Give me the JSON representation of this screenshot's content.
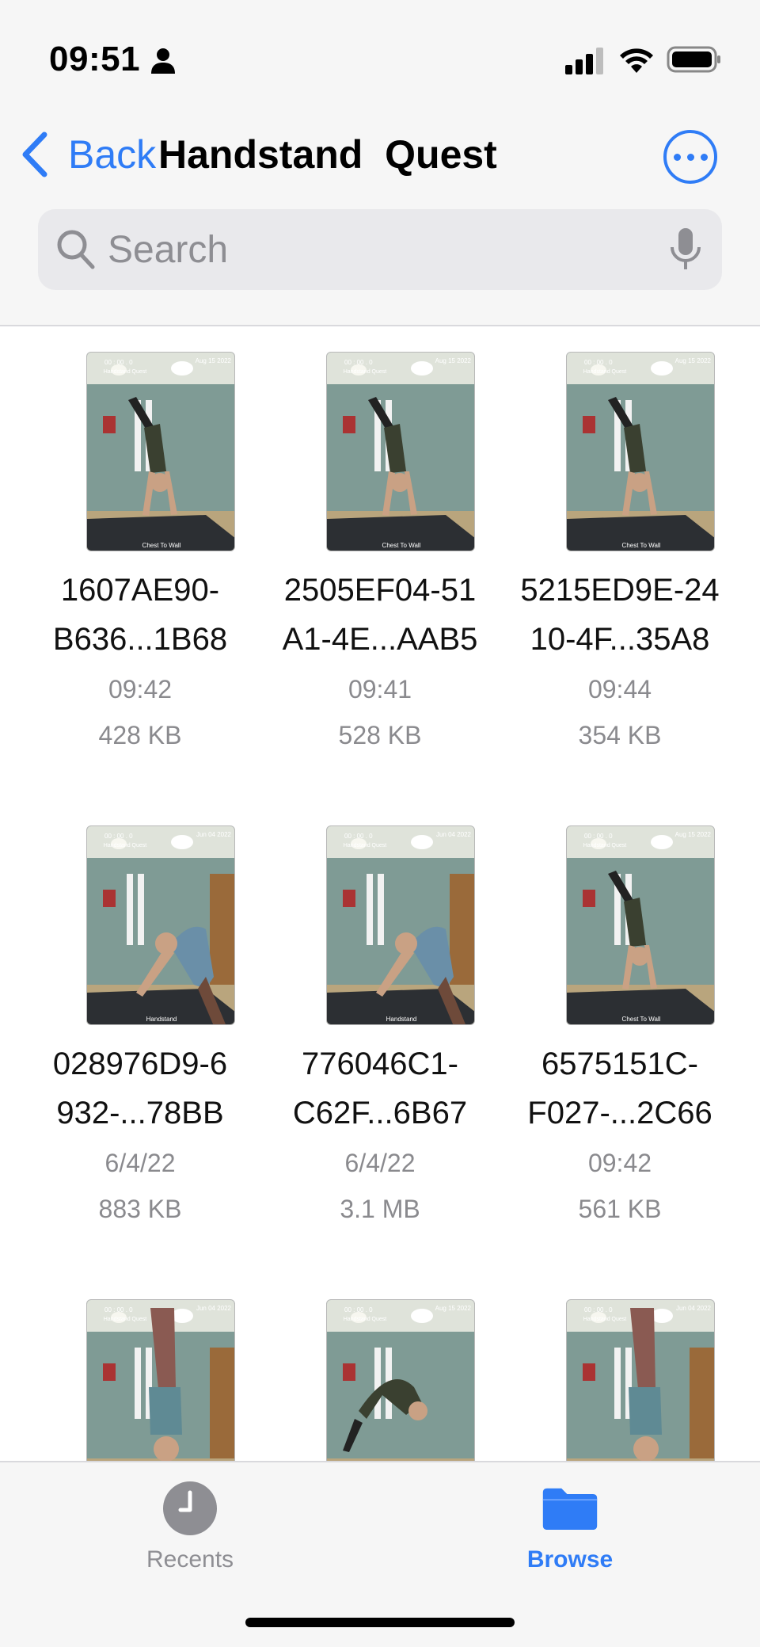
{
  "status_bar": {
    "time": "09:51"
  },
  "nav": {
    "back_label": "Back",
    "title": "Handstand  Quest",
    "more_icon": "ellipsis-circle-icon"
  },
  "search": {
    "placeholder": "Search"
  },
  "files": [
    {
      "name_line1": "1607AE90-",
      "name_line2": "B636...1B68",
      "date": "09:42",
      "size": "428 KB",
      "thumb_date": "Aug 15 2022",
      "thumb_timer": "00 : 00 . 0",
      "thumb_app": "Handstand Quest",
      "thumb_caption": "Chest To Wall"
    },
    {
      "name_line1": "2505EF04-51",
      "name_line2": "A1-4E...AAB5",
      "date": "09:41",
      "size": "528 KB",
      "thumb_date": "Aug 15 2022",
      "thumb_timer": "00 : 00 . 0",
      "thumb_app": "Handstand Quest",
      "thumb_caption": "Chest To Wall"
    },
    {
      "name_line1": "5215ED9E-24",
      "name_line2": "10-4F...35A8",
      "date": "09:44",
      "size": "354 KB",
      "thumb_date": "Aug 15 2022",
      "thumb_timer": "00 : 00 . 0",
      "thumb_app": "Handstand Quest",
      "thumb_caption": "Chest To Wall"
    },
    {
      "name_line1": "028976D9-6",
      "name_line2": "932-...78BB",
      "date": "6/4/22",
      "size": "883 KB",
      "thumb_date": "Jun 04 2022",
      "thumb_timer": "00 : 00 . 0",
      "thumb_app": "Handstand Quest",
      "thumb_caption": "Handstand"
    },
    {
      "name_line1": "776046C1-",
      "name_line2": "C62F...6B67",
      "date": "6/4/22",
      "size": "3.1 MB",
      "thumb_date": "Jun 04 2022",
      "thumb_timer": "00 : 00 . 0",
      "thumb_app": "Handstand Quest",
      "thumb_caption": "Handstand"
    },
    {
      "name_line1": "6575151C-",
      "name_line2": "F027-...2C66",
      "date": "09:42",
      "size": "561 KB",
      "thumb_date": "Aug 15 2022",
      "thumb_timer": "00 : 00 . 0",
      "thumb_app": "Handstand Quest",
      "thumb_caption": "Chest To Wall"
    },
    {
      "name_line1": "",
      "name_line2": "",
      "date": "",
      "size": "",
      "thumb_date": "Jun 04 2022",
      "thumb_timer": "00 : 00 . 0",
      "thumb_app": "Handstand Quest",
      "thumb_caption": ""
    },
    {
      "name_line1": "",
      "name_line2": "",
      "date": "",
      "size": "",
      "thumb_date": "Aug 15 2022",
      "thumb_timer": "00 : 00 . 0",
      "thumb_app": "Handstand Quest",
      "thumb_caption": ""
    },
    {
      "name_line1": "",
      "name_line2": "",
      "date": "",
      "size": "",
      "thumb_date": "Jun 04 2022",
      "thumb_timer": "00 : 00 . 0",
      "thumb_app": "Handstand Quest",
      "thumb_caption": ""
    }
  ],
  "tabs": [
    {
      "label": "Recents",
      "icon": "clock-icon",
      "active": false
    },
    {
      "label": "Browse",
      "icon": "folder-icon",
      "active": true
    }
  ],
  "colors": {
    "accent": "#2f7cf6",
    "secondary_text": "#8a8a8e",
    "bar_background": "#f6f6f6"
  }
}
